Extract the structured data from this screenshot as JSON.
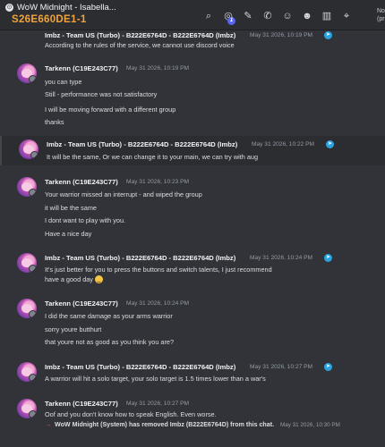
{
  "window": {
    "title": "WoW Midnight - Isabella...",
    "channel_code": "S26E660DE1-1",
    "right_edge_lines": [
      "No",
      "(pr"
    ],
    "toolbar_icons": [
      "search-icon",
      "notification-icon",
      "pin-icon",
      "call-icon",
      "add-member-icon",
      "members-icon",
      "book-icon",
      "location-icon"
    ],
    "notification_count": "1"
  },
  "messages": [
    {
      "author": "Imbz - Team US (Turbo) - B222E6764D - B222E6764D (Imbz)",
      "time": "May 31 2026, 10:19 PM",
      "telegram": true,
      "highlight": false,
      "lines": [
        "According to the rules of the service, we cannot use discord voice"
      ]
    },
    {
      "author": "Tarkenn (C19E243C77)",
      "time": "May 31 2026, 10:19 PM",
      "telegram": false,
      "highlight": false,
      "lines": [
        "you can type",
        "Still - performance was not satisfactory",
        "I will be moving forward with a different group",
        "thanks"
      ]
    },
    {
      "author": "Imbz - Team US (Turbo) - B222E6764D - B222E6764D (Imbz)",
      "time": "May 31 2026, 10:22 PM",
      "telegram": true,
      "highlight": true,
      "lines": [
        "It will be the same, Or we can change it to your main, we can try with aug"
      ]
    },
    {
      "author": "Tarkenn (C19E243C77)",
      "time": "May 31 2026, 10:23 PM",
      "telegram": false,
      "highlight": false,
      "lines": [
        "Your warrior missed an interrupt - and wiped the group",
        "it will be the same",
        "I dont want to play with you.",
        "Have a nice day"
      ]
    },
    {
      "author": "Imbz - Team US (Turbo) - B222E6764D - B222E6764D (Imbz)",
      "time": "May 31 2026, 10:24 PM",
      "telegram": true,
      "highlight": false,
      "lines": [
        "It's just better for you to press the buttons and switch talents, I just recommend",
        "have a good day"
      ]
    },
    {
      "author": "Tarkenn (C19E243C77)",
      "time": "May 31 2026, 10:24 PM",
      "telegram": false,
      "highlight": false,
      "lines": [
        "I did the same damage as your arms warrior",
        "sorry youre butthurt",
        "that youre not as good as you think you are?"
      ]
    },
    {
      "author": "Imbz - Team US (Turbo) - B222E6764D - B222E6764D (Imbz)",
      "time": "May 31 2026, 10:27 PM",
      "telegram": true,
      "highlight": false,
      "lines": [
        "A warrior will hit a solo target, your solo target is 1.5 times lower than a war's"
      ]
    },
    {
      "author": "Tarkenn (C19E243C77)",
      "time": "May 31 2026, 10:27 PM",
      "telegram": false,
      "highlight": false,
      "lines": [
        "Oof and you don't know how to speak English.  Even worse."
      ]
    }
  ],
  "system_message": {
    "text": "WoW Midnight (System) has removed Imbz (B222E6764D) from this chat.",
    "time": "May 31 2026, 10:30 PM"
  },
  "colors": {
    "background": "#313338",
    "topbar": "#2b2d31",
    "channel_code": "#f0a33a",
    "telegram_badge": "#2aa3e0",
    "system_arrow": "#da373c"
  }
}
